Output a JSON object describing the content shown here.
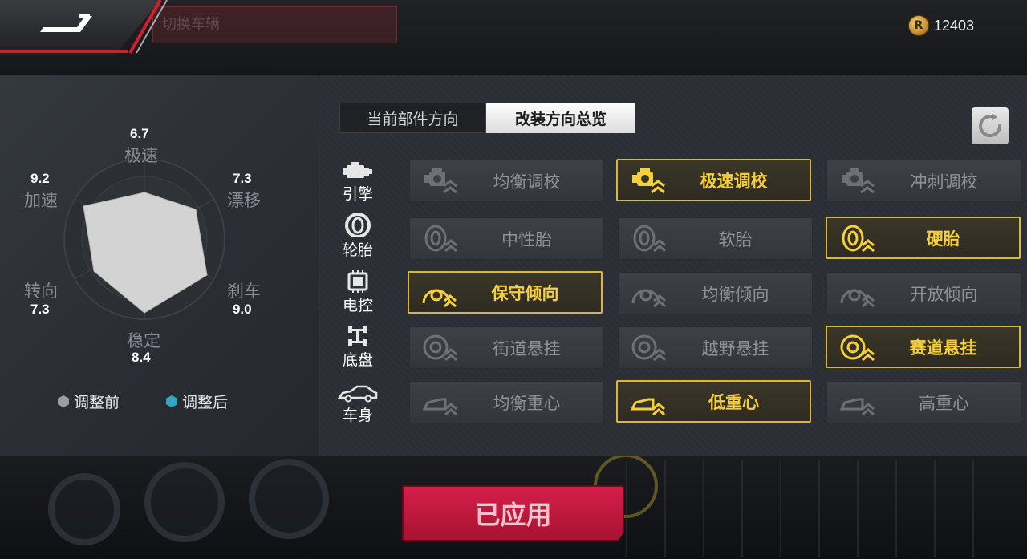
{
  "currency": {
    "icon": "coin-icon",
    "glyph": "R",
    "value": "12403"
  },
  "background": {
    "hint_text": "切换车辆"
  },
  "stats": {
    "top_speed": {
      "label": "极速",
      "value": "6.7"
    },
    "drift": {
      "label": "漂移",
      "value": "7.3"
    },
    "brake": {
      "label": "刹车",
      "value": "9.0"
    },
    "stability": {
      "label": "稳定",
      "value": "8.4"
    },
    "steering": {
      "label": "转向",
      "value": "7.3"
    },
    "acceleration": {
      "label": "加速",
      "value": "9.2"
    }
  },
  "legend": {
    "before": "调整前",
    "after": "调整后"
  },
  "tabs": [
    {
      "label": "当前部件方向",
      "active": false
    },
    {
      "label": "改装方向总览",
      "active": true
    }
  ],
  "categories": [
    {
      "label": "引擎",
      "icon": "engine-icon"
    },
    {
      "label": "轮胎",
      "icon": "tire-icon"
    },
    {
      "label": "电控",
      "icon": "ecu-chip-icon"
    },
    {
      "label": "底盘",
      "icon": "chassis-icon"
    },
    {
      "label": "车身",
      "icon": "car-body-icon"
    }
  ],
  "options": [
    [
      {
        "label": "均衡调校",
        "selected": false
      },
      {
        "label": "极速调校",
        "selected": true
      },
      {
        "label": "冲刺调校",
        "selected": false
      }
    ],
    [
      {
        "label": "中性胎",
        "selected": false
      },
      {
        "label": "软胎",
        "selected": false
      },
      {
        "label": "硬胎",
        "selected": true
      }
    ],
    [
      {
        "label": "保守倾向",
        "selected": true
      },
      {
        "label": "均衡倾向",
        "selected": false
      },
      {
        "label": "开放倾向",
        "selected": false
      }
    ],
    [
      {
        "label": "街道悬挂",
        "selected": false
      },
      {
        "label": "越野悬挂",
        "selected": false
      },
      {
        "label": "赛道悬挂",
        "selected": true
      }
    ],
    [
      {
        "label": "均衡重心",
        "selected": false
      },
      {
        "label": "低重心",
        "selected": true
      },
      {
        "label": "高重心",
        "selected": false
      }
    ]
  ],
  "apply_button": {
    "label": "已应用"
  },
  "colors": {
    "accent_yellow": "#d8b73a",
    "apply_red": "#c8173e",
    "radar_fill": "#d9d9d9"
  }
}
